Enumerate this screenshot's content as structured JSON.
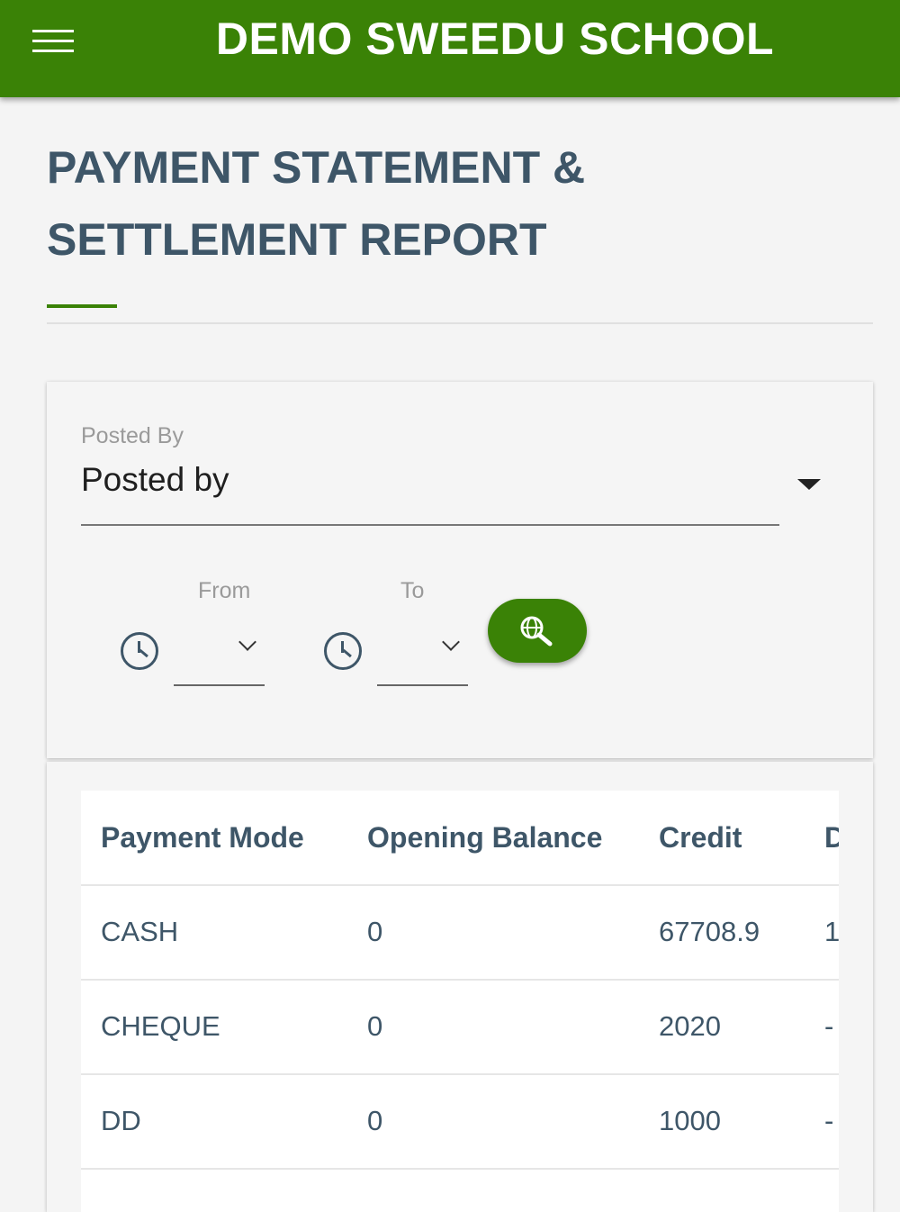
{
  "app": {
    "title": "DEMO SWEEDU SCHOOL"
  },
  "page": {
    "title": "PAYMENT STATEMENT & SETTLEMENT REPORT"
  },
  "filters": {
    "posted_by_label": "Posted By",
    "posted_by_value": "Posted by",
    "from_label": "From",
    "to_label": "To"
  },
  "table": {
    "headers": [
      "Payment Mode",
      "Opening Balance",
      "Credit",
      "D"
    ],
    "rows": [
      [
        "CASH",
        "0",
        "67708.9",
        "1"
      ],
      [
        "CHEQUE",
        "0",
        "2020",
        "-"
      ],
      [
        "DD",
        "0",
        "1000",
        "-"
      ],
      [
        "",
        "",
        "",
        ""
      ]
    ]
  },
  "colors": {
    "primary": "#3a8206",
    "text": "#3e5668",
    "background": "#f4f4f4"
  },
  "icons": {
    "menu": "hamburger-menu-icon",
    "clock": "clock-icon",
    "search": "globe-search-icon",
    "dropdown": "caret-down-icon"
  }
}
